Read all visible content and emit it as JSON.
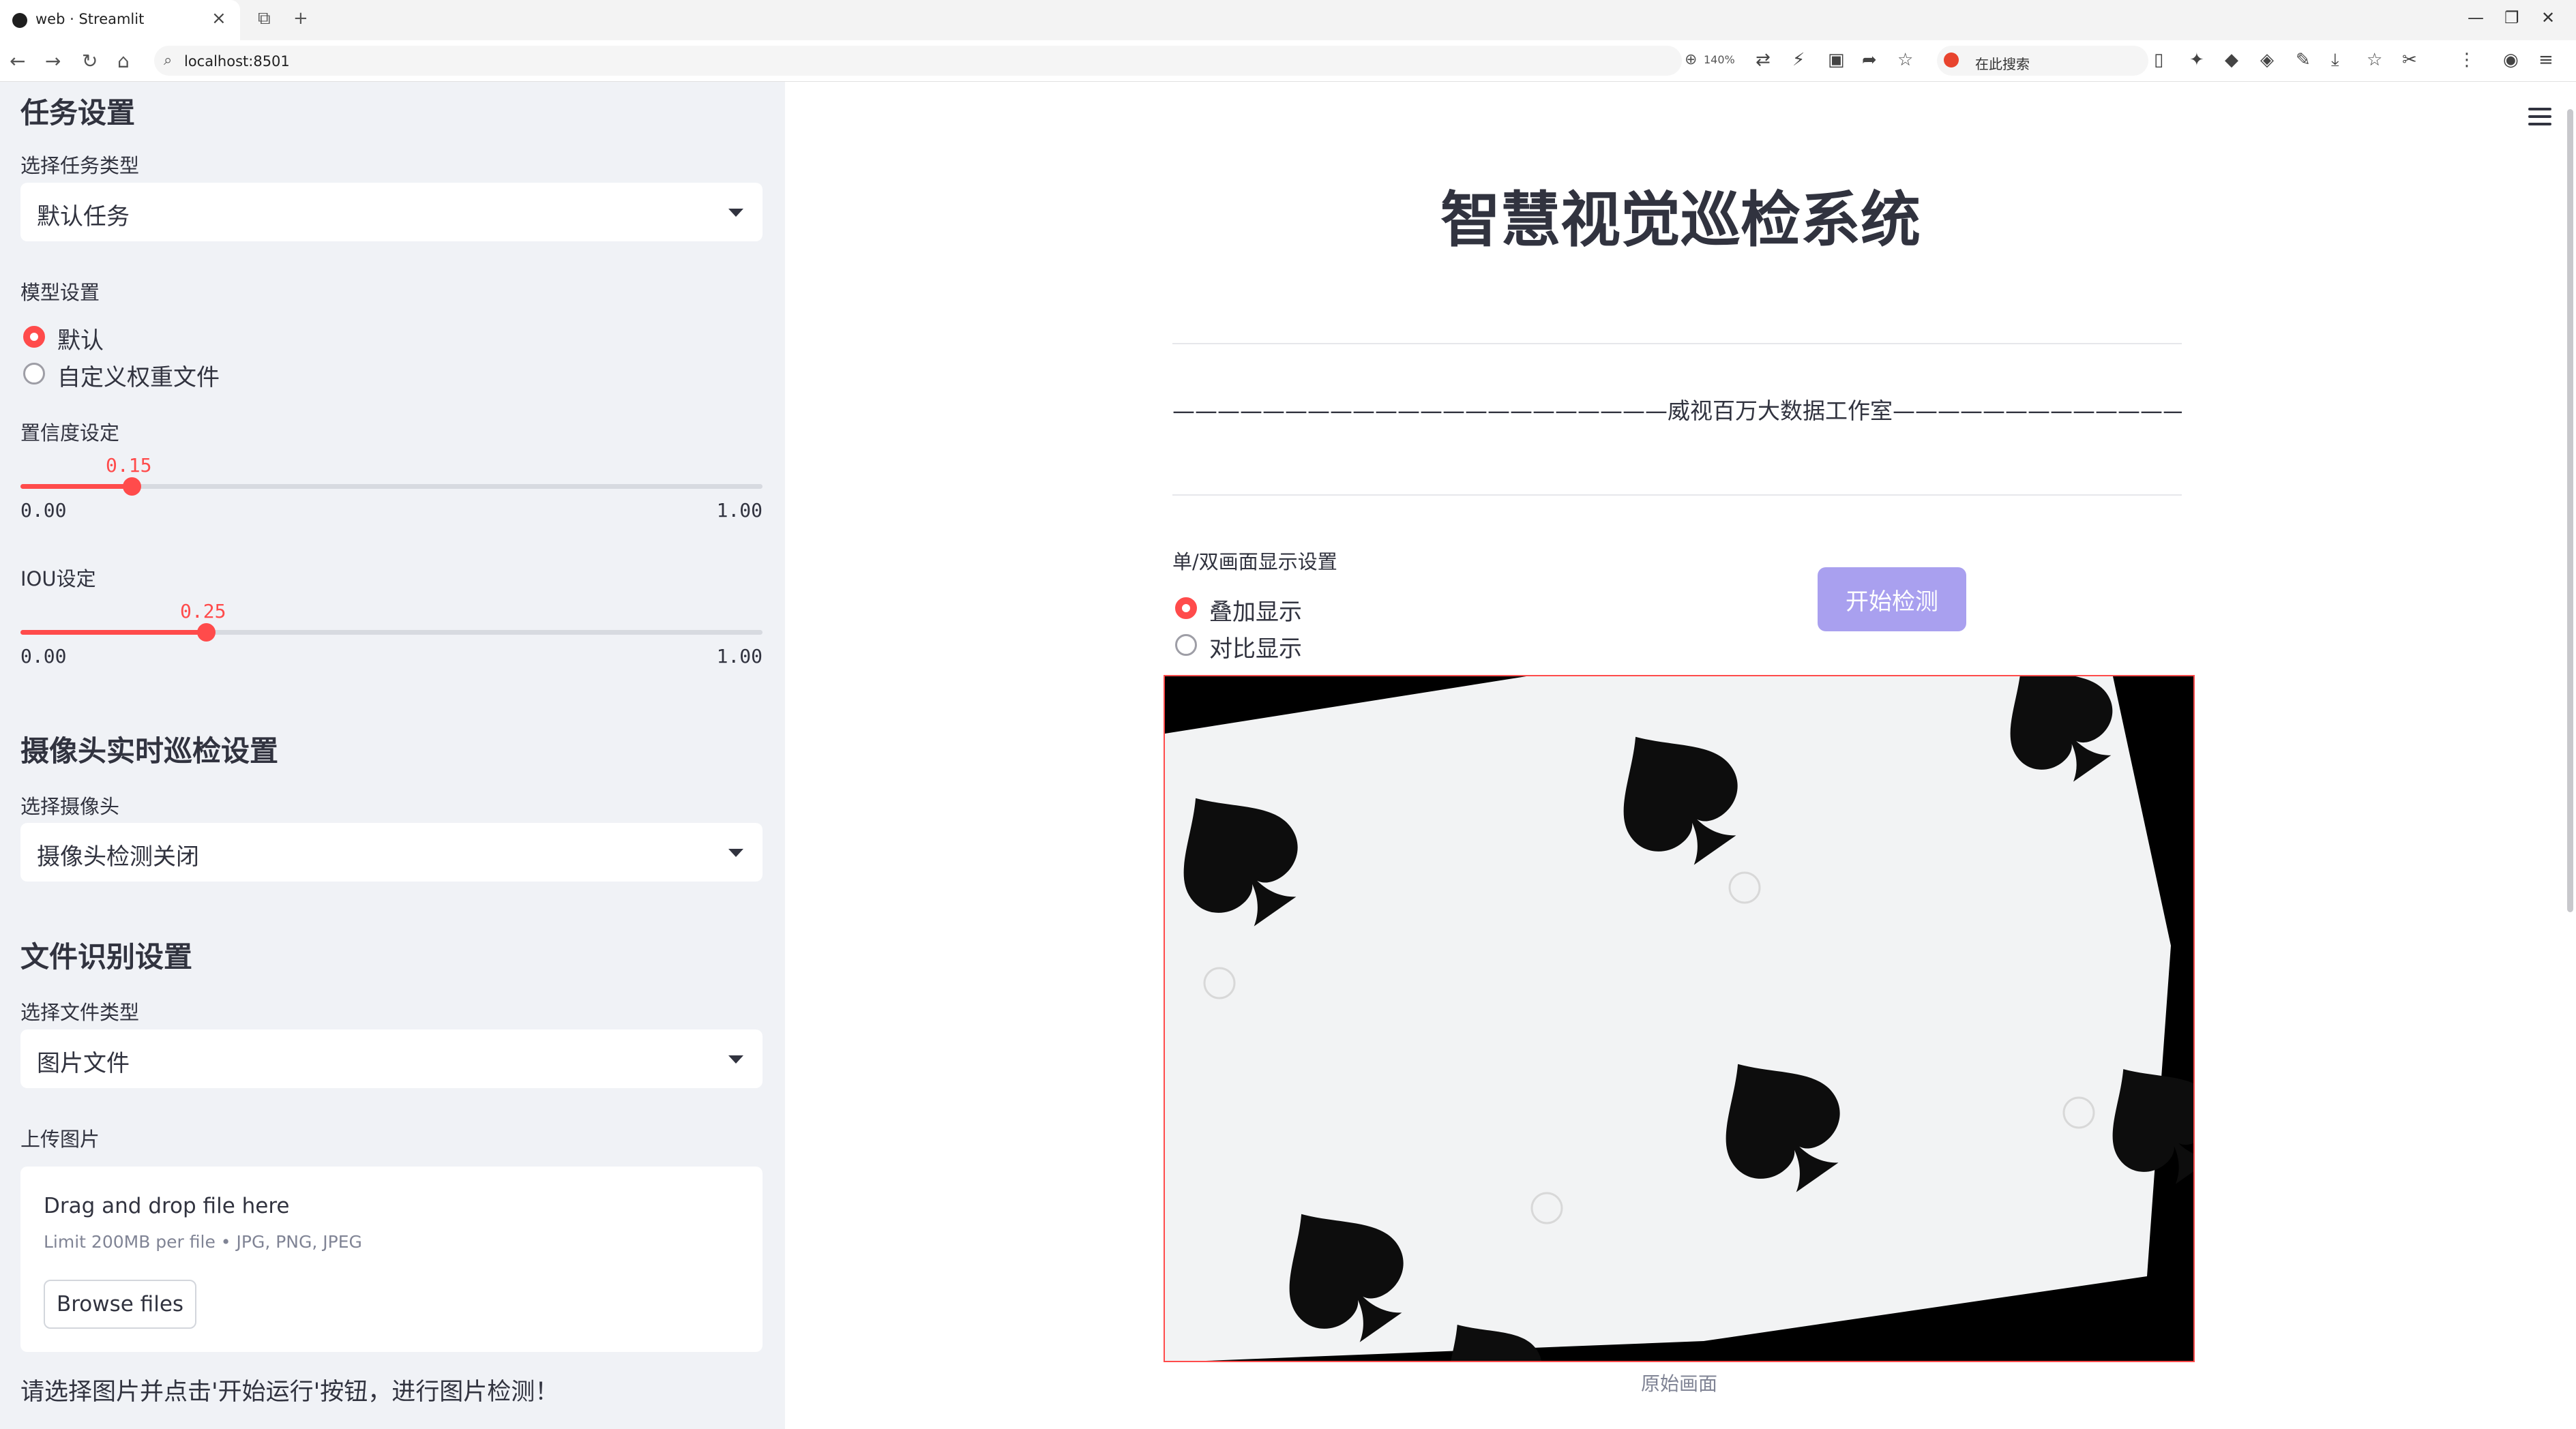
{
  "browser": {
    "tab_title": "web · Streamlit",
    "url": "localhost:8501",
    "zoom": "140%",
    "search_placeholder": "在此搜索"
  },
  "sidebar": {
    "task_heading": "任务设置",
    "task_type_label": "选择任务类型",
    "task_type_value": "默认任务",
    "model_label": "模型设置",
    "model_options": [
      "默认",
      "自定义权重文件"
    ],
    "model_selected": 0,
    "conf_label": "置信度设定",
    "conf": {
      "value": "0.15",
      "min": "0.00",
      "max": "1.00",
      "fraction": 0.15
    },
    "iou_label": "IOU设定",
    "iou": {
      "value": "0.25",
      "min": "0.00",
      "max": "1.00",
      "fraction": 0.25
    },
    "camera_heading": "摄像头实时巡检设置",
    "camera_label": "选择摄像头",
    "camera_value": "摄像头检测关闭",
    "file_heading": "文件识别设置",
    "file_type_label": "选择文件类型",
    "file_type_value": "图片文件",
    "upload_label": "上传图片",
    "upload_title": "Drag and drop file here",
    "upload_limit": "Limit 200MB per file • JPG, PNG, JPEG",
    "browse_label": "Browse files",
    "footer_text": "请选择图片并点击'开始运行'按钮，进行图片检测！"
  },
  "main": {
    "title": "智慧视觉巡检系统",
    "subtitle": "——————————————————————威视百万大数据工作室———————————————————————",
    "display_label": "单/双画面显示设置",
    "display_options": [
      "叠加显示",
      "对比显示"
    ],
    "display_selected": 0,
    "start_button": "开始检测",
    "image_caption": "原始画面"
  },
  "colors": {
    "accent": "#ff4b4b",
    "button": "#a9a0ef",
    "sidebar_bg": "#f0f2f6"
  }
}
